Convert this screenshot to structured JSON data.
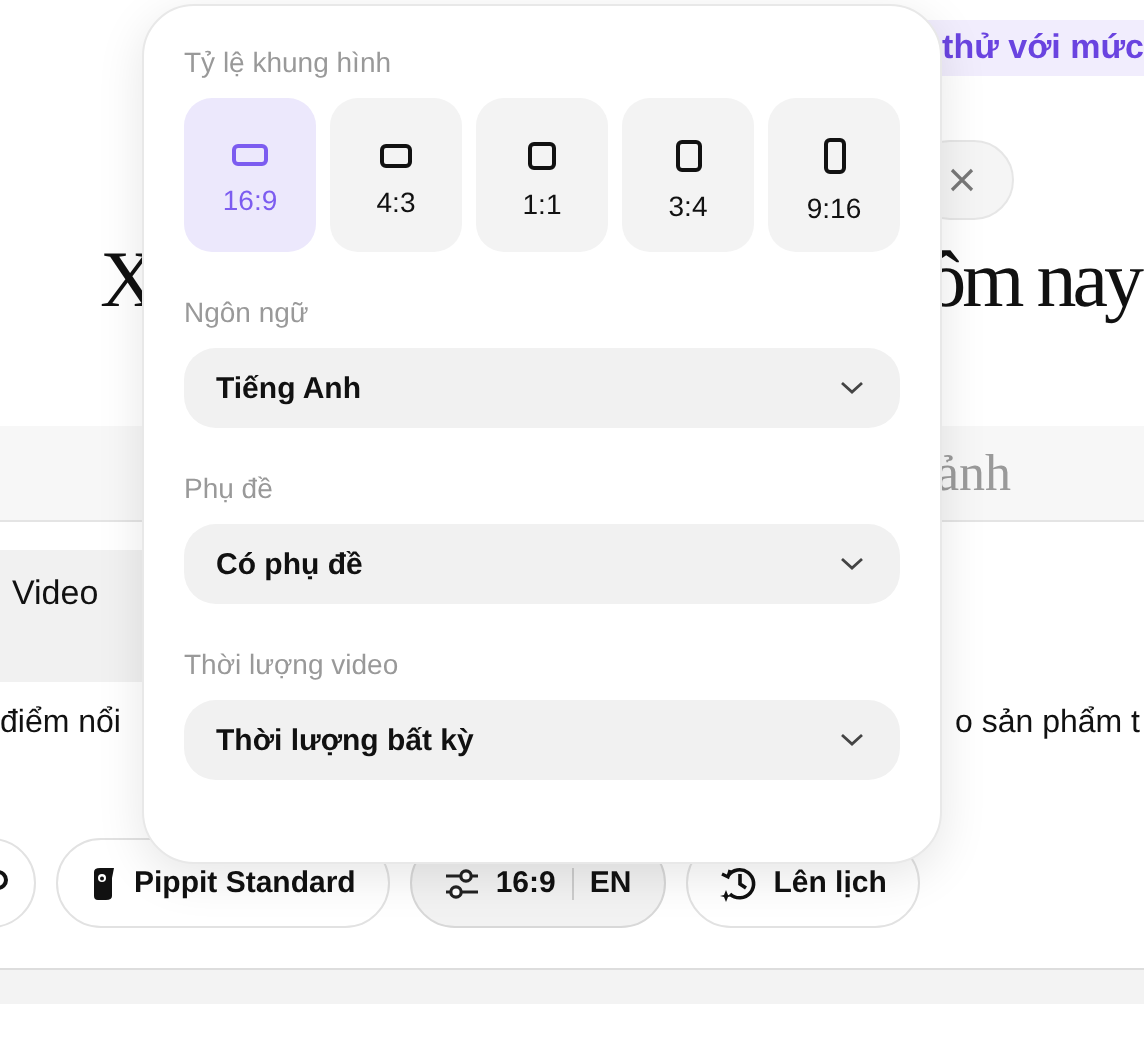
{
  "banner": {
    "text": "thử với mức"
  },
  "heading": {
    "left": "X",
    "right": "ôm nay"
  },
  "prompt": {
    "text": "ảnh"
  },
  "tabs": [
    {
      "label": "Video",
      "selected": true
    }
  ],
  "description": {
    "left": "điểm nổi",
    "right": "o sản phẩm t"
  },
  "toolbar": [
    {
      "kind": "partial"
    },
    {
      "kind": "model",
      "label": "Pippit Standard",
      "selected": false
    },
    {
      "kind": "settings",
      "label": "16:9",
      "language": "EN",
      "selected": true
    },
    {
      "kind": "schedule",
      "label": "Lên lịch",
      "selected": false
    }
  ],
  "popover": {
    "sections": [
      {
        "kind": "ratio",
        "title": "Tỷ lệ khung hình",
        "options": [
          {
            "label": "16:9",
            "kind": "wide",
            "selected": true
          },
          {
            "label": "4:3",
            "kind": "landscape",
            "selected": false
          },
          {
            "label": "1:1",
            "kind": "square",
            "selected": false
          },
          {
            "label": "3:4",
            "kind": "portrait",
            "selected": false
          },
          {
            "label": "9:16",
            "kind": "tall",
            "selected": false
          }
        ]
      },
      {
        "kind": "select",
        "title": "Ngôn ngữ",
        "value": "Tiếng Anh"
      },
      {
        "kind": "select",
        "title": "Phụ đề",
        "value": "Có phụ đề"
      },
      {
        "kind": "select",
        "title": "Thời lượng video",
        "value": "Thời lượng bất kỳ"
      }
    ]
  }
}
